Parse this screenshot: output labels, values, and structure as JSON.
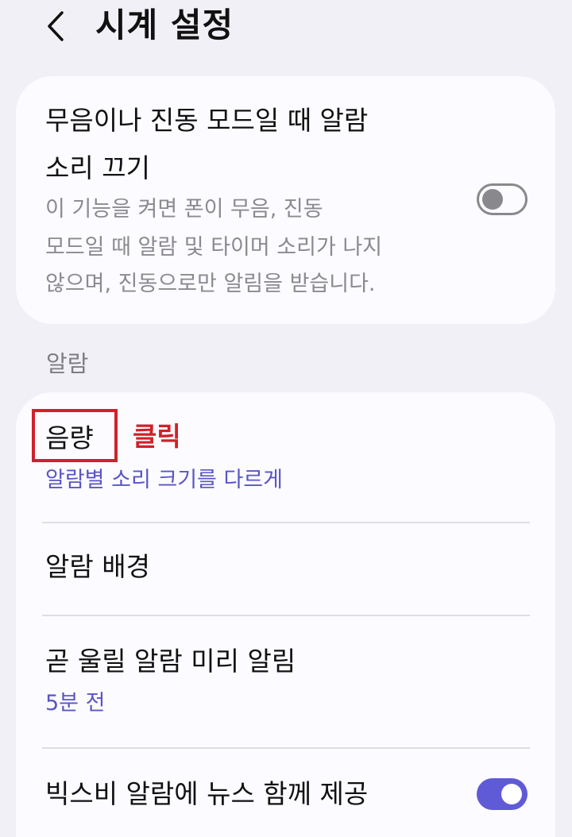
{
  "header": {
    "title": "시계 설정",
    "back_icon": "chevron-left-icon"
  },
  "top_option": {
    "title_line1": "무음이나 진동 모드일 때 알람",
    "title_line2": "소리 끄기",
    "desc_line1": "이 기능을 켜면 폰이 무음, 진동",
    "desc_line2": "모드일 때 알람 및 타이머 소리가 나지",
    "desc_line3": "않으며, 진동으로만 알림을 받습니다.",
    "toggle_state": "off"
  },
  "alarm_section": {
    "label": "알람",
    "items": [
      {
        "title": "음량",
        "subtitle": "알람별 소리 크기를 다르게"
      },
      {
        "title": "알람 배경"
      },
      {
        "title": "곧 울릴 알람 미리 알림",
        "subtitle": "5분 전"
      },
      {
        "title": "빅스비 알람에 뉴스 함께 제공",
        "toggle_state": "on"
      }
    ]
  },
  "annotation": {
    "click_label": "클릭",
    "color": "#d0212a"
  },
  "colors": {
    "accent": "#5f5bd6",
    "subtitle": "#5a56c4",
    "background": "#f1f0f6",
    "card": "#fcfbff"
  }
}
